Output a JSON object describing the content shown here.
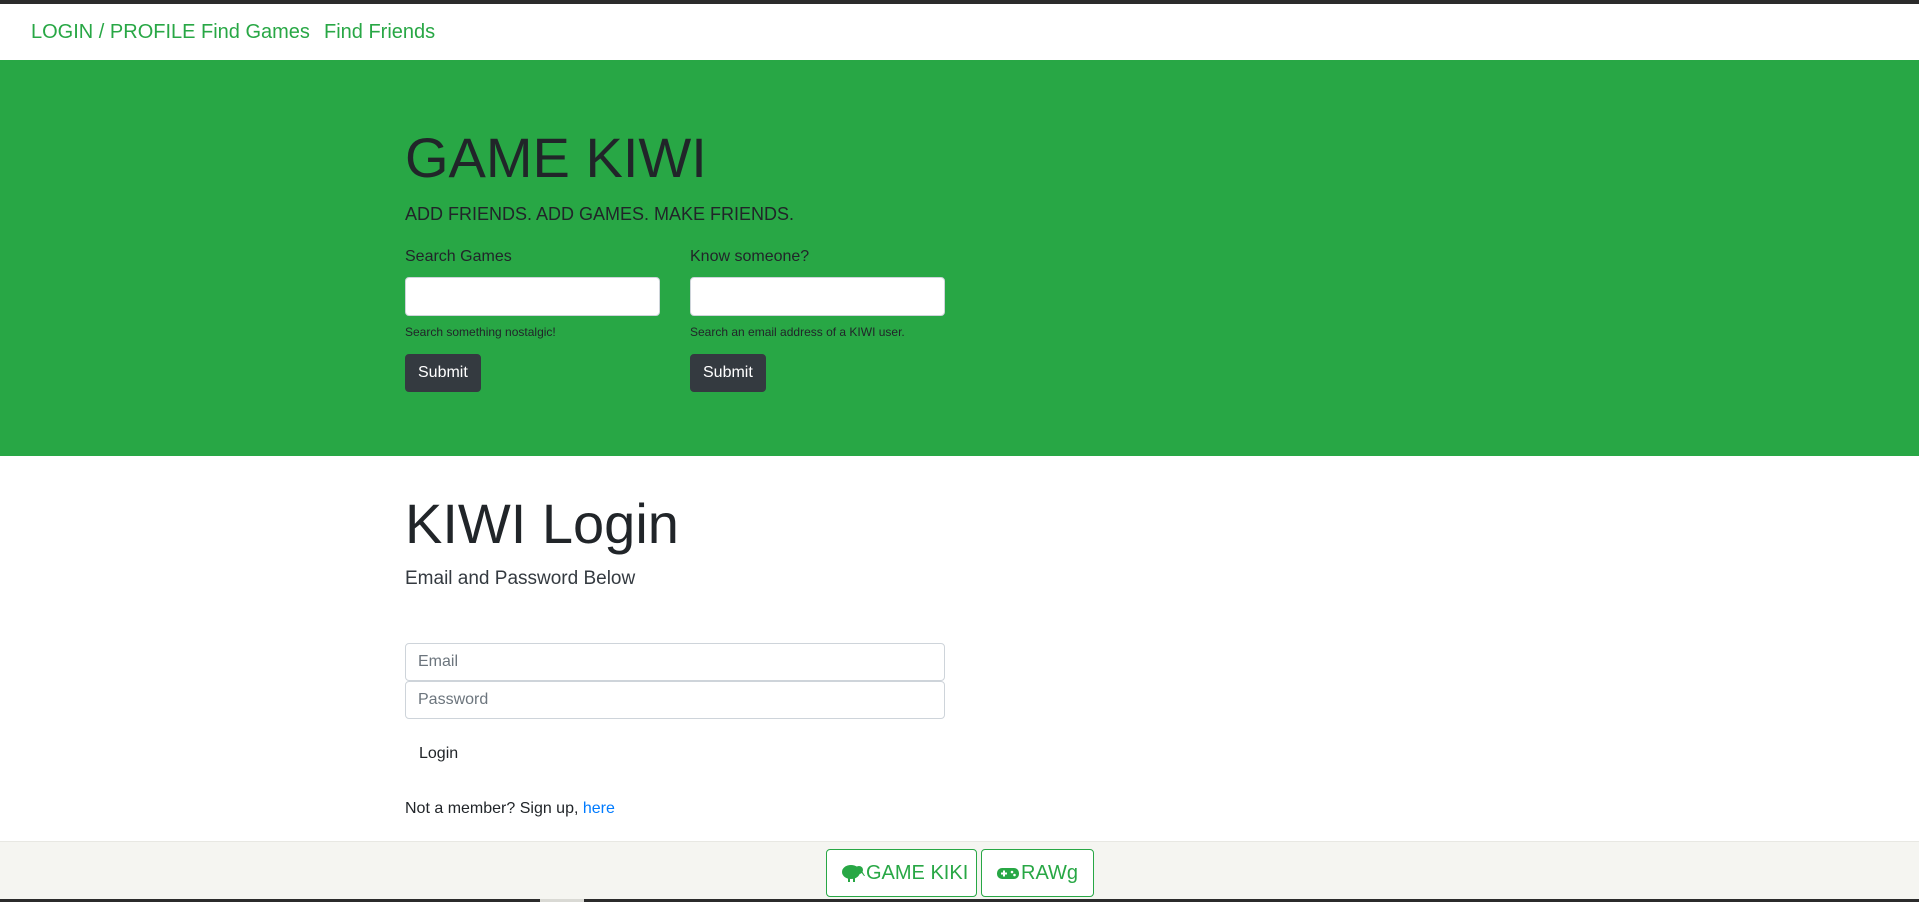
{
  "nav": {
    "login_profile": "LOGIN / PROFILE",
    "find_games": "Find Games",
    "find_friends": "Find Friends"
  },
  "hero": {
    "title": "GAME KIWI",
    "subtitle": "ADD FRIENDS. ADD GAMES. MAKE FRIENDS.",
    "search_games": {
      "label": "Search Games",
      "value": "",
      "help": "Search something nostalgic!",
      "submit_label": "Submit"
    },
    "know_someone": {
      "label": "Know someone?",
      "value": "",
      "help": "Search an email address of a KIWI user.",
      "submit_label": "Submit"
    }
  },
  "login": {
    "title": "KIWI Login",
    "subtitle": "Email and Password Below",
    "email_placeholder": "Email",
    "password_placeholder": "Password",
    "login_label": "Login",
    "signup_text": "Not a member? Sign up, ",
    "signup_link": "here"
  },
  "footer": {
    "game_kiki_label": "GAME KIKI",
    "game_kiki_icon": "kiwi-bird-icon",
    "rawg_label": "RAWg",
    "rawg_icon": "gamepad-icon"
  },
  "colors": {
    "brand_green": "#28a745",
    "dark_button": "#343a40",
    "link_blue": "#007bff",
    "footer_bg": "#f5f5f1"
  }
}
